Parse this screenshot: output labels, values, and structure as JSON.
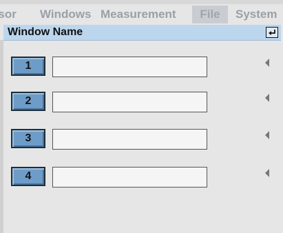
{
  "tabs": [
    "nsor",
    "Windows",
    "Measurement",
    "File",
    "System"
  ],
  "panel": {
    "title": "Window Name",
    "enter_icon": "return-arrow-icon"
  },
  "rows": [
    {
      "label": "1",
      "value": ""
    },
    {
      "label": "2",
      "value": ""
    },
    {
      "label": "3",
      "value": ""
    },
    {
      "label": "4",
      "value": ""
    }
  ],
  "colors": {
    "title_bar": "#bcd6ee",
    "number_button": "#6e9cc8",
    "background": "#e6e6e6"
  }
}
